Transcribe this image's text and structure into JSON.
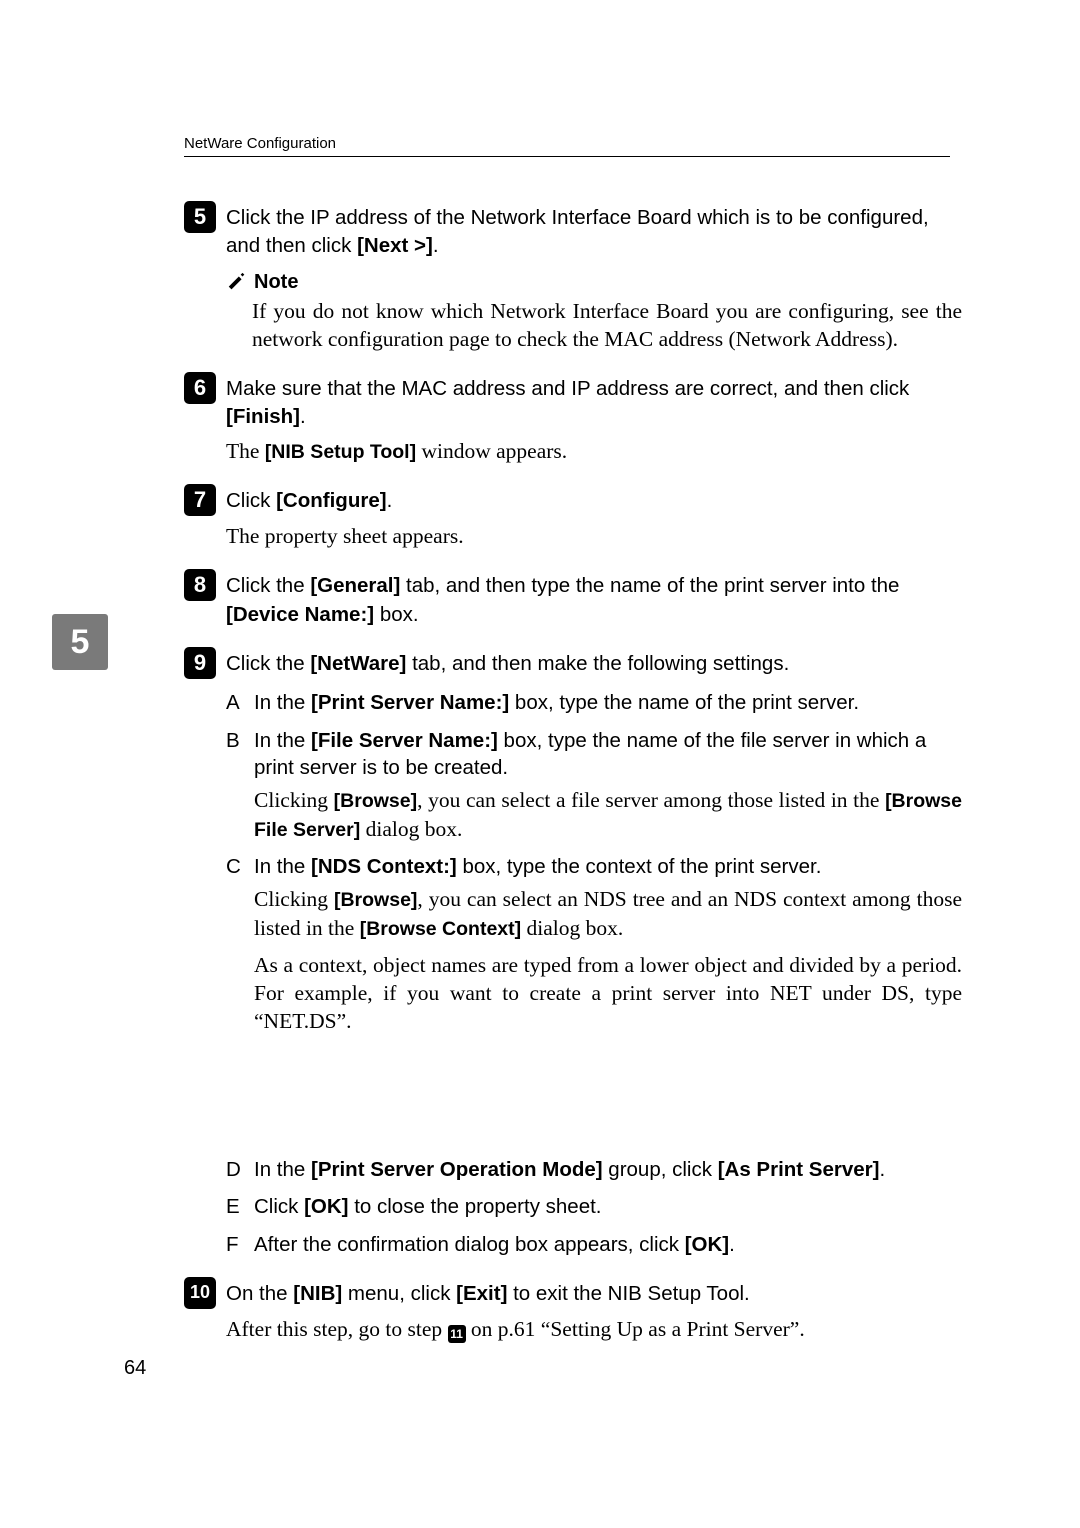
{
  "header": "NetWare Configuration",
  "side_tab": "5",
  "page_number": "64",
  "step5": {
    "num": "5",
    "t1": "Click the IP address of the Network Interface Board which is to be configured, and then click  ",
    "b1": "[Next >]",
    "t2": "."
  },
  "note": {
    "label": "Note",
    "body": "If you do not know which Network Interface Board you are configuring, see the network configuration page to check the MAC address (Network Address)."
  },
  "step6": {
    "num": "6",
    "t1": "Make sure that the MAC address and IP address are correct, and then click ",
    "b1": "[Finish]",
    "t2": ".",
    "cont_a": "The ",
    "cont_b": "[NIB Setup Tool]",
    "cont_c": " window appears."
  },
  "step7": {
    "num": "7",
    "t1": "Click  ",
    "b1": "[Configure]",
    "t2": ".",
    "cont": "The property sheet appears."
  },
  "step8": {
    "num": "8",
    "t1": "Click the  ",
    "b1": "[General]",
    "t2": " tab, and then type the name of the print server into the ",
    "b2": "[Device Name:]",
    "t3": " box."
  },
  "step9": {
    "num": "9",
    "t1": "Click the  ",
    "b1": "[NetWare]",
    "t2": " tab, and then make the following settings."
  },
  "sub": {
    "A": {
      "l": "A",
      "t1": "In the  ",
      "b1": "[Print Server Name:]",
      "t2": " box, type the name of the print server."
    },
    "B": {
      "l": "B",
      "t1": "In the  ",
      "b1": "[File Server Name:]",
      "t2": " box, type the name of the file server in which a print server is to be created."
    },
    "B_serif": {
      "a": "Clicking ",
      "b": "[Browse]",
      "c": ", you can select a file server among those listed in the ",
      "d": "[Browse File Server]",
      "e": " dialog box."
    },
    "C": {
      "l": "C",
      "t1": "In the  ",
      "b1": "[NDS Context:]",
      "t2": " box, type the context of the print server."
    },
    "C_serif1": {
      "a": "Clicking ",
      "b": "[Browse]",
      "c": ", you can select an NDS tree and an NDS context among those listed in the ",
      "d": "[Browse Context]",
      "e": " dialog box."
    },
    "C_serif2": "As a context, object names are typed from a lower object and divided by a period. For example, if you want to create a print server into NET under DS, type “NET.DS”.",
    "D": {
      "l": "D",
      "t1": "In the  ",
      "b1": "[Print Server Operation Mode]",
      "t2": " group, click  ",
      "b2": "[As Print Server]",
      "t3": "."
    },
    "E": {
      "l": "E",
      "t1": "Click  ",
      "b1": "[OK]",
      "t2": " to close the property sheet."
    },
    "F": {
      "l": "F",
      "t1": "After the confirmation dialog box appears, click    ",
      "b1": "[OK]",
      "t2": "."
    }
  },
  "step10": {
    "num": "10",
    "t1": "On the  ",
    "b1": "[NIB]",
    "t2": " menu, click  ",
    "b2": "[Exit]",
    "t3": " to exit the NIB Setup Tool.",
    "cont_a": "After this step, go to step ",
    "inline": "11",
    "cont_b": " on p.61 “Setting Up as a Print Server”."
  }
}
